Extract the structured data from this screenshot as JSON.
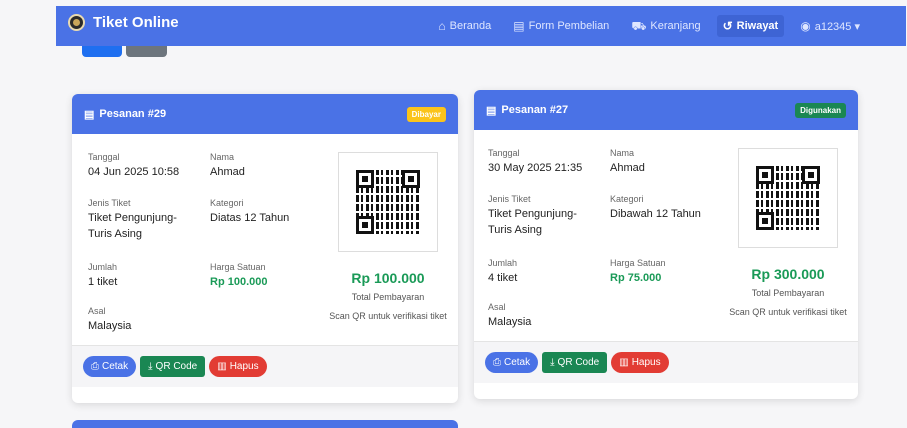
{
  "navbar": {
    "brand": "Tiket Online",
    "items": [
      {
        "label": "Beranda",
        "icon": "home-icon",
        "glyph": "🏠"
      },
      {
        "label": "Form Pembelian",
        "icon": "ticket-icon",
        "glyph": "▭"
      },
      {
        "label": "Keranjang",
        "icon": "cart-icon",
        "glyph": "🛒"
      },
      {
        "label": "Riwayat",
        "icon": "history-icon",
        "glyph": "⟲",
        "active": true
      },
      {
        "label": "a12345 ▾",
        "icon": "user-icon",
        "glyph": "●"
      }
    ]
  },
  "labels": {
    "tanggal": "Tanggal",
    "nama": "Nama",
    "jenis": "Jenis Tiket",
    "kategori": "Kategori",
    "jumlah": "Jumlah",
    "harga": "Harga Satuan",
    "asal": "Asal",
    "total": "Total Pembayaran",
    "scan": "Scan QR untuk verifikasi tiket",
    "cetak": "Cetak",
    "qr": "QR Code",
    "hapus": "Hapus"
  },
  "orders": [
    {
      "title": "Pesanan #29",
      "status": "Dibayar",
      "tanggal": "04 Jun 2025 10:58",
      "nama": "Ahmad",
      "jenis": "Tiket Pengunjung-Turis Asing",
      "kategori": "Diatas 12 Tahun",
      "jumlah": "1 tiket",
      "harga": "Rp 100.000",
      "asal": "Malaysia",
      "total": "Rp 100.000"
    },
    {
      "title": "Pesanan #27",
      "status": "Digunakan",
      "tanggal": "30 May 2025 21:35",
      "nama": "Ahmad",
      "jenis": "Tiket Pengunjung-Turis Asing",
      "kategori": "Dibawah 12 Tahun",
      "jumlah": "4 tiket",
      "harga": "Rp 75.000",
      "asal": "Malaysia",
      "total": "Rp 300.000"
    }
  ]
}
